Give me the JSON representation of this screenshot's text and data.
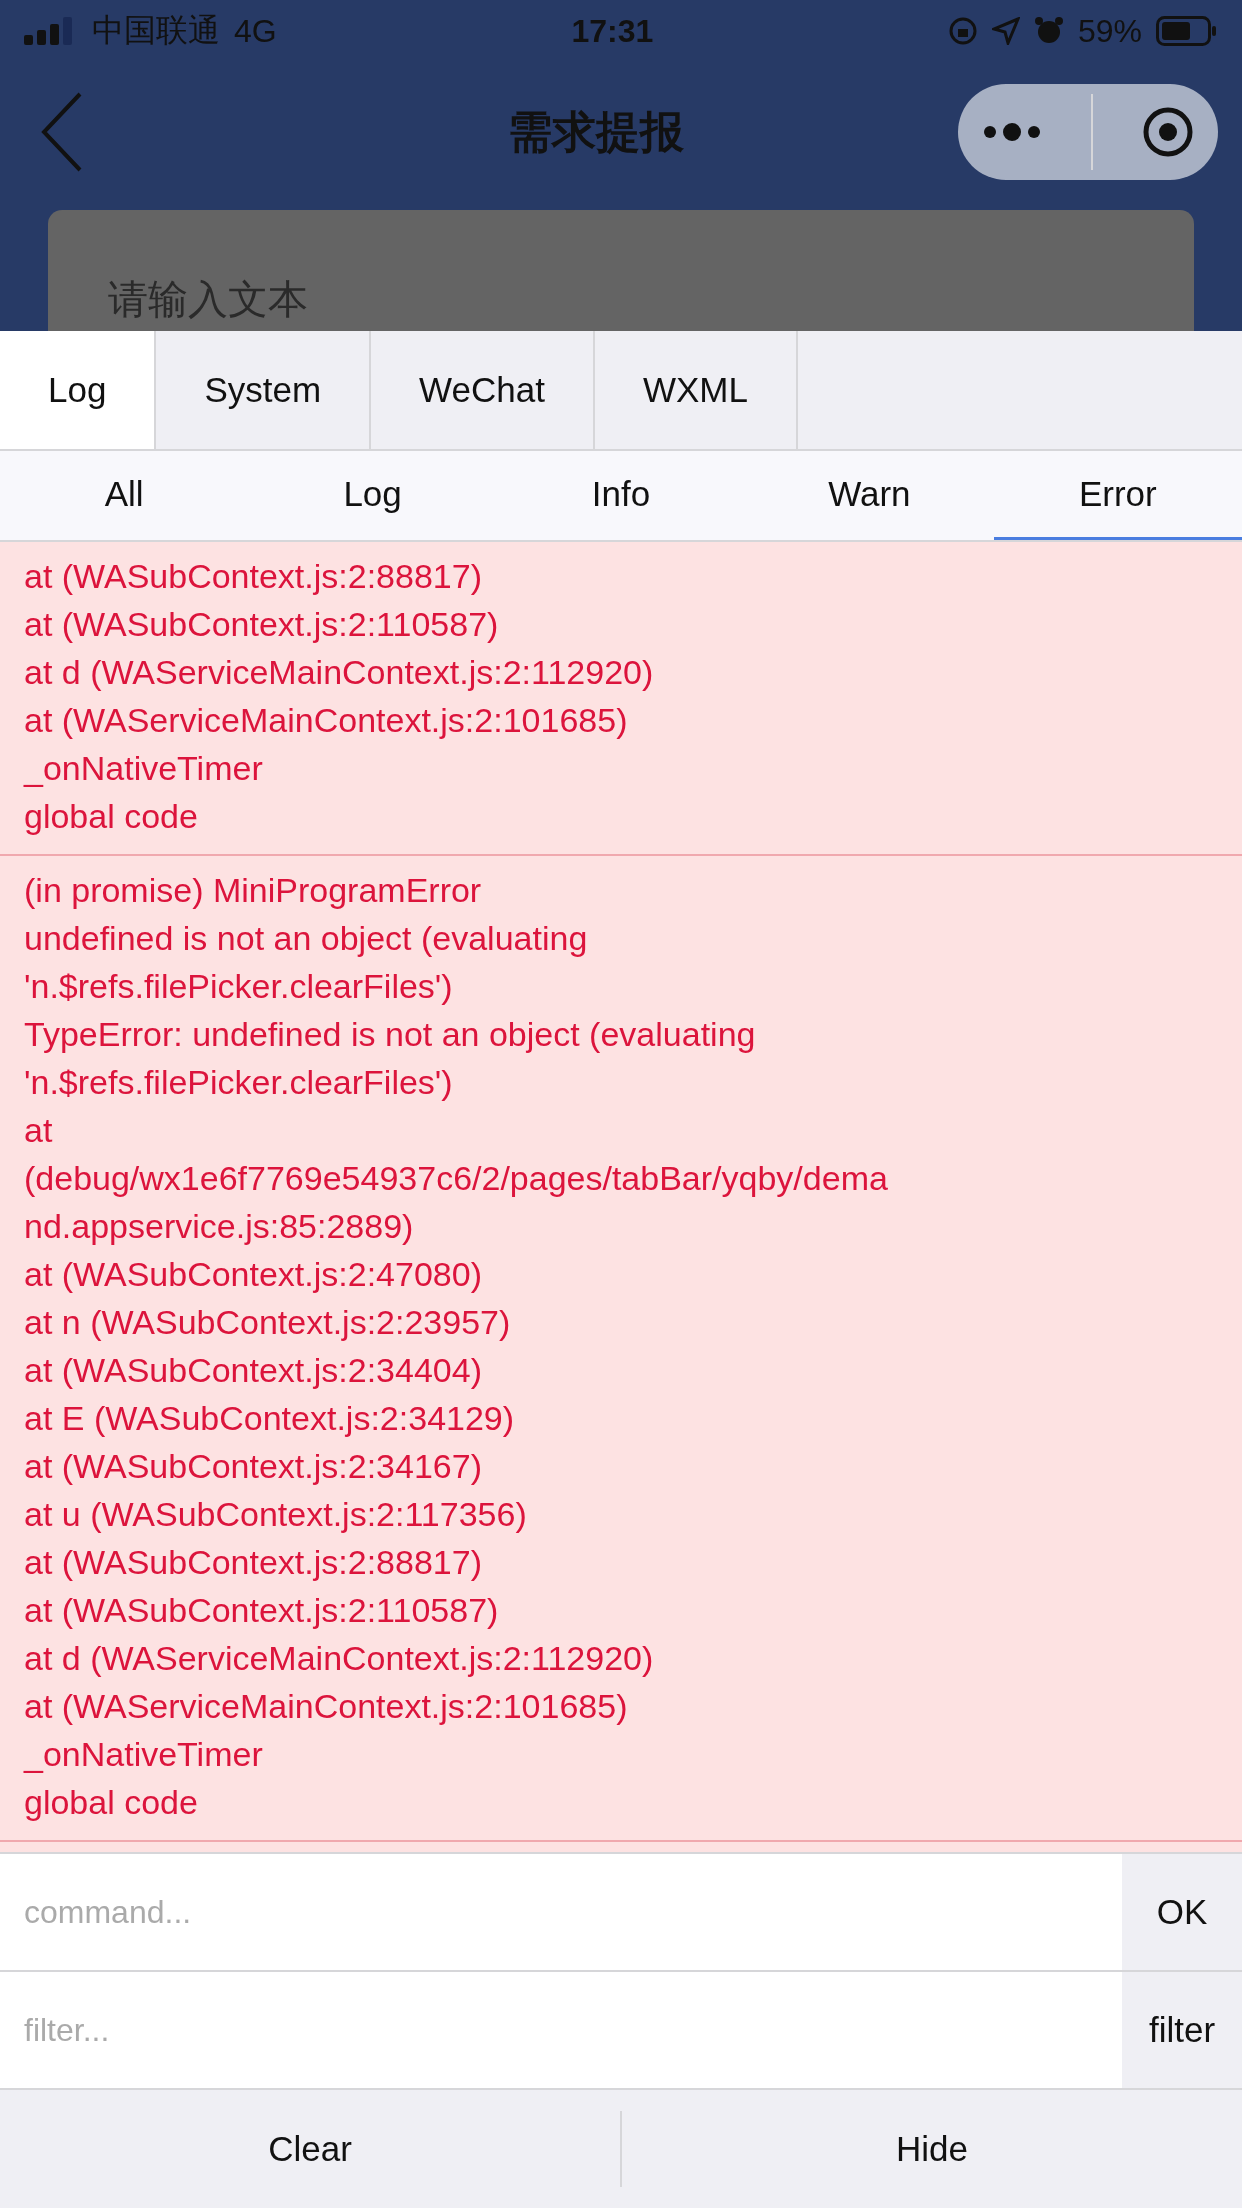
{
  "status_bar": {
    "carrier": "中国联通",
    "network": "4G",
    "time": "17:31",
    "battery": "59%"
  },
  "nav": {
    "title": "需求提报"
  },
  "form": {
    "placeholder": "请输入文本"
  },
  "tabs": [
    {
      "label": "Log",
      "selected": true
    },
    {
      "label": "System",
      "selected": false
    },
    {
      "label": "WeChat",
      "selected": false
    },
    {
      "label": "WXML",
      "selected": false
    }
  ],
  "filters": [
    {
      "label": "All",
      "selected": false
    },
    {
      "label": "Log",
      "selected": false
    },
    {
      "label": "Info",
      "selected": false
    },
    {
      "label": "Warn",
      "selected": false
    },
    {
      "label": "Error",
      "selected": true
    }
  ],
  "entries": [
    {
      "lines": [
        "at (WASubContext.js:2:88817)",
        "at (WASubContext.js:2:110587)",
        "at d (WAServiceMainContext.js:2:112920)",
        "at (WAServiceMainContext.js:2:101685)",
        "_onNativeTimer",
        "global code"
      ]
    },
    {
      "lines": [
        "(in promise) MiniProgramError",
        "undefined is not an object (evaluating",
        "'n.$refs.filePicker.clearFiles')",
        "TypeError: undefined is not an object (evaluating",
        "'n.$refs.filePicker.clearFiles')",
        "at",
        "(debug/wx1e6f7769e54937c6/2/pages/tabBar/yqby/dema",
        "nd.appservice.js:85:2889)",
        "at (WASubContext.js:2:47080)",
        "at n (WASubContext.js:2:23957)",
        "at (WASubContext.js:2:34404)",
        "at E (WASubContext.js:2:34129)",
        "at (WASubContext.js:2:34167)",
        "at u (WASubContext.js:2:117356)",
        "at (WASubContext.js:2:88817)",
        "at (WASubContext.js:2:110587)",
        "at d (WAServiceMainContext.js:2:112920)",
        "at (WAServiceMainContext.js:2:101685)",
        "_onNativeTimer",
        "global code"
      ]
    }
  ],
  "command": {
    "placeholder": "command...",
    "button": "OK"
  },
  "filter": {
    "placeholder": "filter...",
    "button": "filter"
  },
  "footer": [
    "Clear",
    "Hide"
  ]
}
